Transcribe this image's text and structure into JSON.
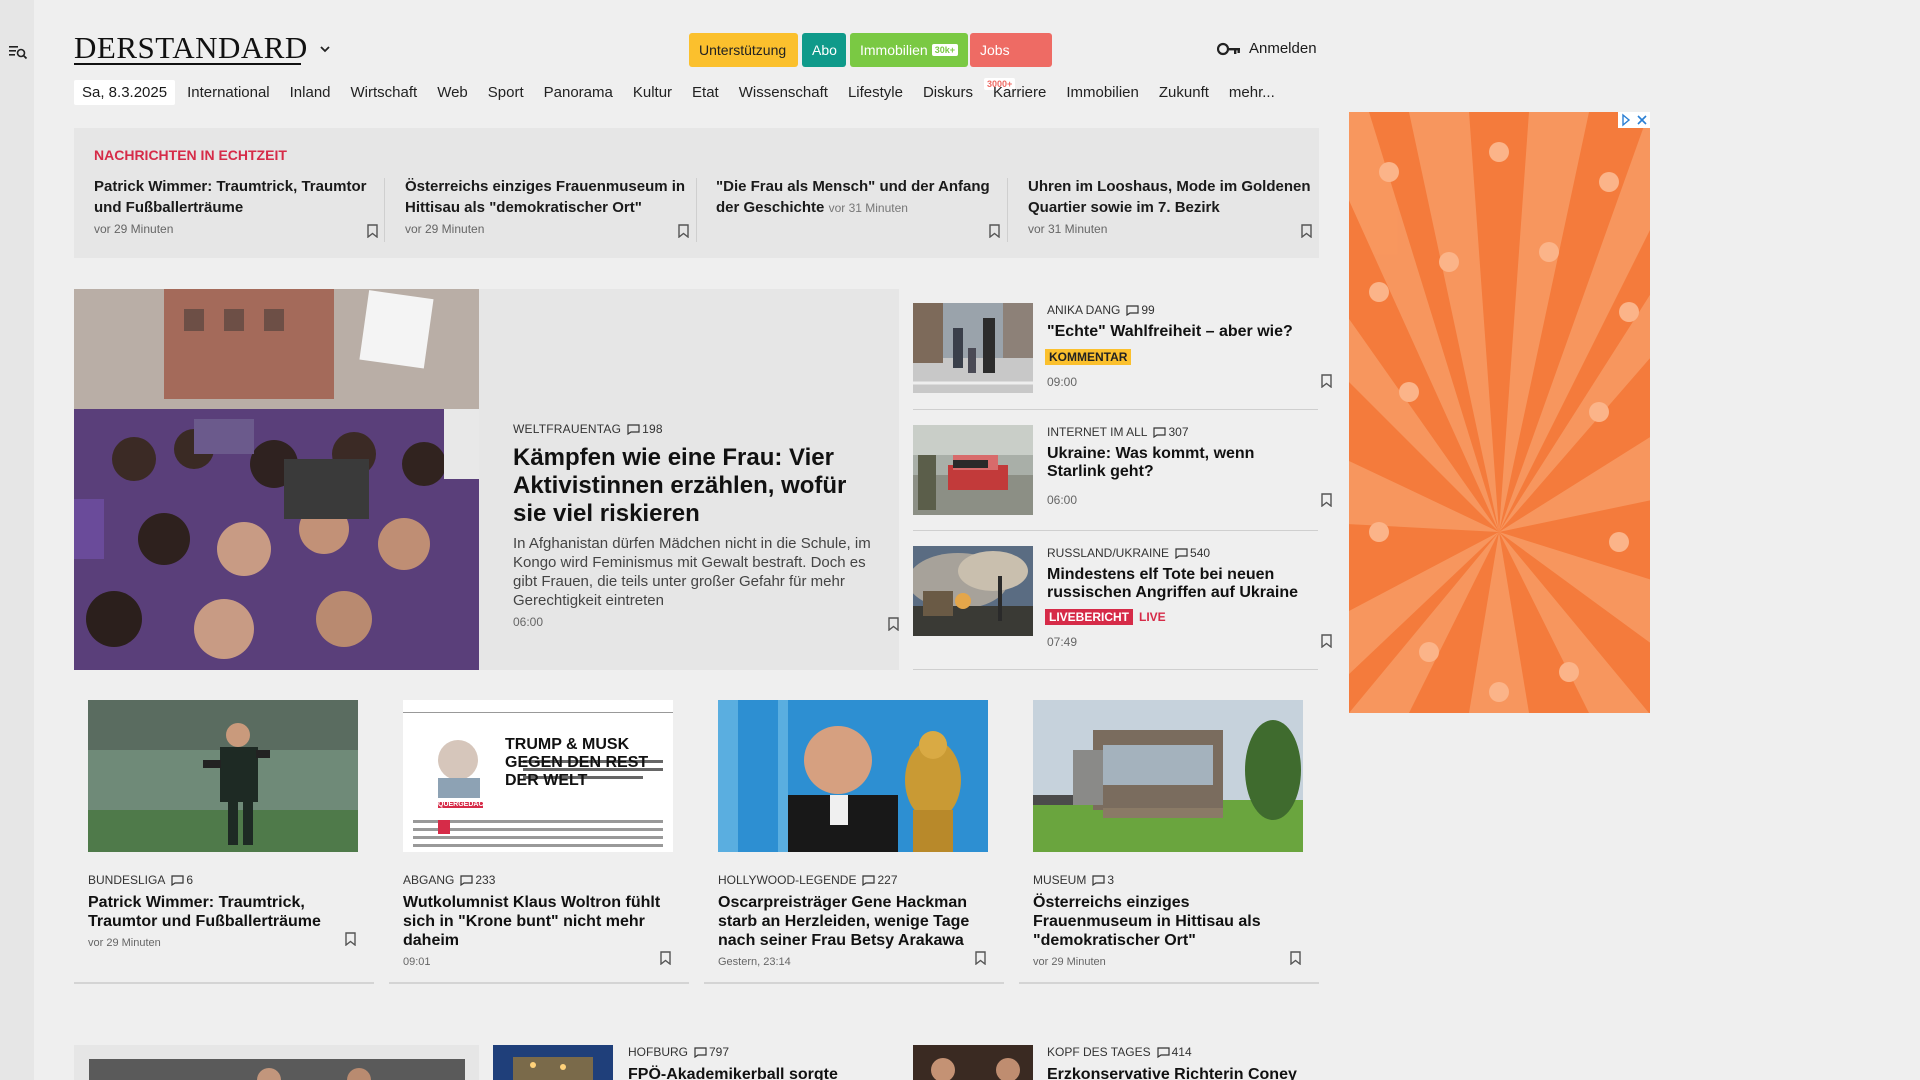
{
  "brand": {
    "logo": "DERSTANDARD"
  },
  "header": {
    "pills": {
      "support": "Unterstützung",
      "abo": "Abo",
      "immobilien": "Immobilien",
      "immobilien_badge": "30k+",
      "jobs": "Jobs",
      "jobs_badge": "3000+"
    },
    "login": "Anmelden"
  },
  "nav": {
    "date": "Sa, 8.3.2025",
    "items": [
      "International",
      "Inland",
      "Wirtschaft",
      "Web",
      "Sport",
      "Panorama",
      "Kultur",
      "Etat",
      "Wissenschaft",
      "Lifestyle",
      "Diskurs",
      "Karriere",
      "Immobilien",
      "Zukunft",
      "mehr..."
    ]
  },
  "ticker": {
    "title": "NACHRICHTEN IN ECHTZEIT",
    "items": [
      {
        "title": "Patrick Wimmer: Traumtrick, Traumtor und Fußballerträume",
        "time": "vor 29 Minuten"
      },
      {
        "title": "Österreichs einziges Frauenmuseum in Hittisau als \"demokratischer Ort\"",
        "time": "vor 29 Minuten"
      },
      {
        "title": "\"Die Frau als Mensch\" und der Anfang der Geschichte",
        "time": "vor 31 Minuten"
      },
      {
        "title": "Uhren im Looshaus, Mode im Goldenen Quartier sowie im 7. Bezirk",
        "time": "vor 31 Minuten"
      }
    ]
  },
  "hero": {
    "kicker": "WELTFRAUENTAG",
    "comments": "198",
    "title": "Kämpfen wie eine Frau: Vier Aktivistinnen erzählen, wofür sie viel riskieren",
    "text": "In Afghanistan dürfen Mädchen nicht in die Schule, im Kongo wird Feminismus mit Gewalt bestraft. Doch es gibt Frauen, die teils unter großer Gefahr für mehr Gerechtigkeit eintreten",
    "time": "06:00"
  },
  "side": [
    {
      "kicker": "ANIKA DANG",
      "comments": "99",
      "title": "\"Echte\" Wahlfreiheit – aber wie?",
      "label": "KOMMENTAR",
      "time": "09:00"
    },
    {
      "kicker": "INTERNET IM ALL",
      "comments": "307",
      "title": "Ukraine: Was kommt, wenn Starlink geht?",
      "time": "06:00"
    },
    {
      "kicker": "RUSSLAND/UKRAINE",
      "comments": "540",
      "title": "Mindestens elf Tote bei neuen russischen Angriffen auf Ukraine",
      "label": "LIVEBERICHT",
      "live": "LIVE",
      "time": "07:49"
    }
  ],
  "cards": [
    {
      "kicker": "BUNDESLIGA",
      "comments": "6",
      "title": "Patrick Wimmer: Traumtrick, Traumtor und Fußballerträume",
      "time": "vor 29 Minuten"
    },
    {
      "kicker": "ABGANG",
      "comments": "233",
      "title": "Wutkolumnist Klaus Woltron fühlt sich in \"Krone bunt\" nicht mehr daheim",
      "time": "09:01",
      "img_headline": "TRUMP & MUSK GEGEN DEN REST DER WELT",
      "img_tag": "QUERGEDACHT"
    },
    {
      "kicker": "HOLLYWOOD-LEGENDE",
      "comments": "227",
      "title": "Oscarpreisträger Gene Hackman starb an Herzleiden, wenige Tage nach seiner Frau Betsy Arakawa",
      "time": "Gestern, 23:14"
    },
    {
      "kicker": "MUSEUM",
      "comments": "3",
      "title": "Österreichs einziges Frauenmuseum in Hittisau als \"demokratischer Ort\"",
      "time": "vor 29 Minuten"
    }
  ],
  "bottom": [
    {
      "kicker": "HOFBURG",
      "comments": "797",
      "title": "FPÖ-Akademikerball sorgte"
    },
    {
      "kicker": "KOPF DES TAGES",
      "comments": "414",
      "title": "Erzkonservative Richterin Coney"
    }
  ],
  "colors": {
    "accent_red": "#d62b48",
    "support_yellow": "#fbc02d",
    "abo_teal": "#0f9a8a",
    "immo_green": "#7ac943",
    "jobs_red": "#ee6b64",
    "ad_orange": "#f47b3c"
  }
}
